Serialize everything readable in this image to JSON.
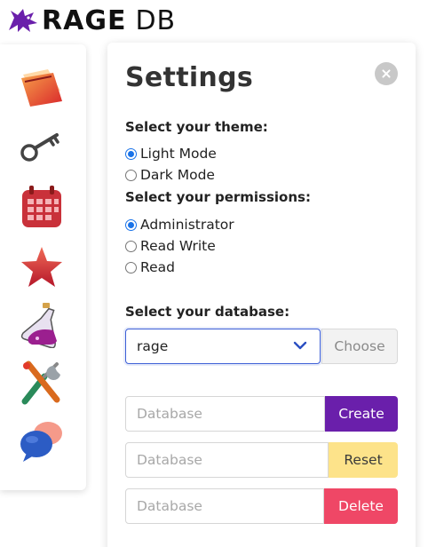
{
  "brand": {
    "name_bold": "RAGE",
    "name_light": "DB",
    "accent_color": "#6a1fab"
  },
  "sidebar": {
    "items": [
      {
        "icon": "folder-icon"
      },
      {
        "icon": "key-icon"
      },
      {
        "icon": "calendar-icon"
      },
      {
        "icon": "star-icon"
      },
      {
        "icon": "flask-icon"
      },
      {
        "icon": "tools-icon"
      },
      {
        "icon": "chat-bubbles-icon"
      }
    ]
  },
  "settings": {
    "title": "Settings",
    "theme": {
      "label": "Select your theme:",
      "options": [
        "Light Mode",
        "Dark Mode"
      ],
      "selected": "Light Mode"
    },
    "permissions": {
      "label": "Select your permissions:",
      "options": [
        "Administrator",
        "Read Write",
        "Read"
      ],
      "selected": "Administrator"
    },
    "database": {
      "label": "Select your database:",
      "selected": "rage",
      "choose_label": "Choose"
    },
    "actions": [
      {
        "placeholder": "Database",
        "button": "Create",
        "color": "#6a1fab"
      },
      {
        "placeholder": "Database",
        "button": "Reset",
        "color": "#fde38a"
      },
      {
        "placeholder": "Database",
        "button": "Delete",
        "color": "#ef4766"
      }
    ]
  }
}
